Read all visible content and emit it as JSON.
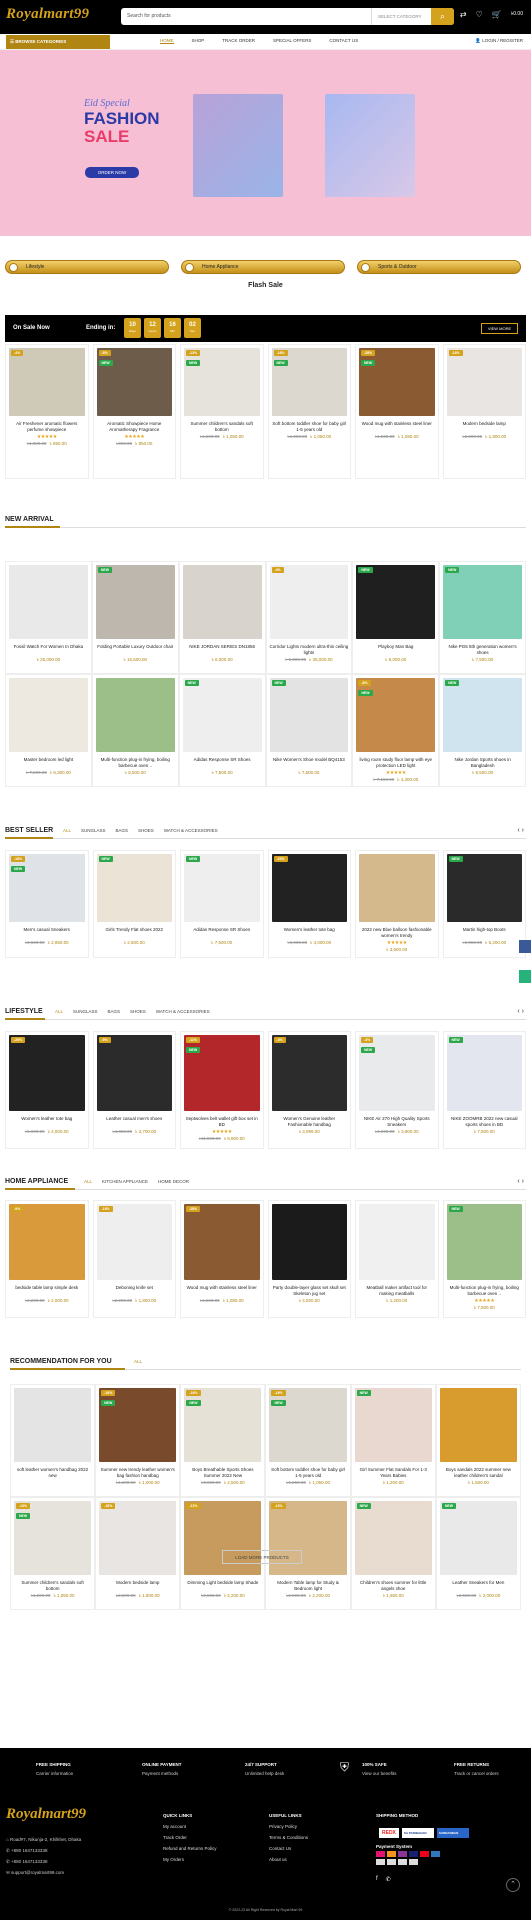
{
  "header": {
    "logo": "Royalmart99",
    "search_placeholder": "Search for products",
    "category_select": "SELECT CATEGORY",
    "search_icon": "search-icon",
    "cart_total": "৳0.00"
  },
  "nav": {
    "browse": "BROWSE CATEGORIES",
    "links": [
      "HOME",
      "SHOP",
      "TRACK ORDER",
      "SPECIAL OFFERS",
      "CONTACT US"
    ],
    "active": "HOME",
    "login": "LOGIN / REGISTER"
  },
  "banner": {
    "line1": "Eid Special",
    "line2": "FASHION",
    "line3": "SALE",
    "button": "ORDER NOW"
  },
  "categories": [
    "Lifestyle",
    "Home Appliance",
    "Sports & Outdoor"
  ],
  "flash": {
    "title": "Flash Sale",
    "on_sale": "On Sale Now",
    "ending": "Ending in:",
    "countdown": [
      {
        "v": "10",
        "u": "Days"
      },
      {
        "v": "12",
        "u": "Hours"
      },
      {
        "v": "16",
        "u": "Min"
      },
      {
        "v": "02",
        "u": "Sec"
      }
    ],
    "view_more": "VIEW MORE",
    "products": [
      {
        "name": "Air Freshener aromatic flowers perfume showpiece",
        "stars": "★★★★★",
        "old": "৳1,020.00",
        "price": "৳ 850.00",
        "badge": "-4%",
        "new": false,
        "color": "#cfc9b8"
      },
      {
        "name": "Aromatic Showpiece Home Aromatherapy Fragrance",
        "stars": "★★★★★",
        "old": "৳900.00",
        "price": "৳ 850.00",
        "badge": "-8%",
        "new": true,
        "color": "#6d5c4a"
      },
      {
        "name": "Summer children's sandals soft bottom",
        "stars": "",
        "old": "৳1,200.00",
        "price": "৳ 1,050.00",
        "badge": "-13%",
        "new": true,
        "color": "#e6e2dc"
      },
      {
        "name": "Soft bottom toddler shoe for baby girl 1-5 years old",
        "stars": "",
        "old": "৳1,250.00",
        "price": "৳ 1,050.00",
        "badge": "-16%",
        "new": true,
        "color": "#dcd7cf"
      },
      {
        "name": "Wood mug with stainless steel liner",
        "stars": "",
        "old": "৳1,500.00",
        "price": "৳ 1,080.00",
        "badge": "-28%",
        "new": true,
        "color": "#8a5a33"
      },
      {
        "name": "Modern bedside lamp",
        "stars": "",
        "old": "৳2,200.00",
        "price": "৳ 1,800.00",
        "badge": "-18%",
        "new": false,
        "color": "#e9e5e2"
      }
    ]
  },
  "new_arrival": {
    "title": "NEW ARRIVAL",
    "products": [
      {
        "name": "Fossil Watch For Women In Dhaka",
        "stars": "",
        "old": "",
        "price": "৳ 25,000.00",
        "badge": "",
        "new": false,
        "color": "#e9e9e9"
      },
      {
        "name": "Folding Portable Luxury Outdoor chair",
        "stars": "",
        "old": "",
        "price": "৳ 15,500.00",
        "badge": "",
        "new": true,
        "color": "#bdb7ae"
      },
      {
        "name": "NIKE JORDAN SERIES DN1856",
        "stars": "",
        "old": "",
        "price": "৳ 6,000.00",
        "badge": "",
        "new": false,
        "color": "#d8d3cd"
      },
      {
        "name": "Corridor Lights modern ultra-thin ceiling lights",
        "stars": "",
        "old": "৳ 1,000.00",
        "price": "৳ 35,000.00",
        "badge": "-4%",
        "new": false,
        "color": "#eeeeee"
      },
      {
        "name": "Playboy Man Bag",
        "stars": "",
        "old": "",
        "price": "৳ 8,000.00",
        "badge": "",
        "new": true,
        "color": "#1f1f1f"
      },
      {
        "name": "Nike PG5 5th generation women's shoes",
        "stars": "",
        "old": "",
        "price": "৳ 7,500.00",
        "badge": "",
        "new": true,
        "color": "#7fd0b6"
      },
      {
        "name": "Master bedroom led light",
        "stars": "",
        "old": "৳ 7,200.00",
        "price": "৳ 6,300.00",
        "badge": "",
        "new": false,
        "color": "#ede8e0"
      },
      {
        "name": "Multi-function plug-in frying, boiling barbecue oven ..",
        "stars": "",
        "old": "",
        "price": "৳ 8,500.00",
        "badge": "",
        "new": false,
        "color": "#9cbf8a"
      },
      {
        "name": "Adidas Response SR Shoes",
        "stars": "",
        "old": "",
        "price": "৳ 7,500.00",
        "badge": "",
        "new": true,
        "color": "#eeeeee"
      },
      {
        "name": "Nike Women's Shoe model BQ4153",
        "stars": "",
        "old": "",
        "price": "৳ 7,500.00",
        "badge": "",
        "new": true,
        "color": "#e3e3e3"
      },
      {
        "name": "living room study floor lamp with eye protection LED light",
        "stars": "★★★★★",
        "old": "৳ 7,150.00",
        "price": "৳ 4,300.00",
        "badge": "-8%",
        "new": true,
        "color": "#c58a4a"
      },
      {
        "name": "Nike Jordan Sports shoes in Bangladesh",
        "stars": "",
        "old": "",
        "price": "৳ 9,500.00",
        "badge": "",
        "new": true,
        "color": "#cfe4ef"
      }
    ]
  },
  "best_seller": {
    "title": "BEST SELLER",
    "tabs": [
      "ALL",
      "SUNGLASS",
      "BAGS",
      "SHOES",
      "WATCH & ACCESSORIES"
    ],
    "products": [
      {
        "name": "Men's casual Sneakers",
        "stars": "",
        "old": "৳3,500.00",
        "price": "৳ 2,950.00",
        "badge": "-16%",
        "new": true,
        "color": "#dfe2e6"
      },
      {
        "name": "Girls Trendy Flat shoes 2022",
        "stars": "",
        "old": "",
        "price": "৳ 2,500.00",
        "badge": "",
        "new": true,
        "color": "#eae3d6"
      },
      {
        "name": "Adidas Response SR Shoes",
        "stars": "",
        "old": "",
        "price": "৳ 7,500.00",
        "badge": "",
        "new": true,
        "color": "#eeeeee"
      },
      {
        "name": "Women's leather tote bag",
        "stars": "",
        "old": "৳5,000.00",
        "price": "৳ 4,000.00",
        "badge": "-20%",
        "new": false,
        "color": "#222222"
      },
      {
        "name": "2022 new Blue balloon fashionable women's trendy",
        "stars": "★★★★★",
        "old": "",
        "price": "৳ 3,500.00",
        "badge": "",
        "new": false,
        "color": "#d4b98c"
      },
      {
        "name": "Martin high-top Boots",
        "stars": "",
        "old": "৳6,950.00",
        "price": "৳ 6,200.00",
        "badge": "",
        "new": true,
        "color": "#2a2a2a"
      }
    ]
  },
  "lifestyle": {
    "title": "LIFESTYLE",
    "tabs": [
      "ALL",
      "SUNGLASS",
      "BAGS",
      "SHOES",
      "WATCH & ACCESSORIES"
    ],
    "products": [
      {
        "name": "Women's leather tote bag",
        "stars": "",
        "old": "৳5,000.00",
        "price": "৳ 4,000.00",
        "badge": "-20%",
        "new": false,
        "color": "#222222"
      },
      {
        "name": "Leather casual men's shoes",
        "stars": "",
        "old": "৳4,050.00",
        "price": "৳ 3,700.00",
        "badge": "-9%",
        "new": false,
        "color": "#2b2b2b"
      },
      {
        "name": "Septwolves belt wallet gift box set in BD",
        "stars": "★★★★★",
        "old": "৳11,000.00",
        "price": "৳ 9,800.00",
        "badge": "-11%",
        "new": true,
        "color": "#b3262a"
      },
      {
        "name": "Women's Genuine leather Fashionable handbag",
        "stars": "",
        "old": "",
        "price": "৳ 3,999.00",
        "badge": "-4%",
        "new": false,
        "color": "#2c2c2c"
      },
      {
        "name": "NIKE Air 270 High Quality Sports Sneakers",
        "stars": "",
        "old": "৳4,000.00",
        "price": "৳ 3,900.00",
        "badge": "-3%",
        "new": true,
        "color": "#e8eaec"
      },
      {
        "name": "NIKE ZOOMRB 2022 new casual sports shoes in BD",
        "stars": "",
        "old": "",
        "price": "৳ 7,500.00",
        "badge": "",
        "new": true,
        "color": "#e3e6ef"
      }
    ]
  },
  "home_appliance": {
    "title": "HOME APPLIANCE",
    "tabs": [
      "ALL",
      "KITCHEN APPLIANCE",
      "HOME DECOR"
    ],
    "products": [
      {
        "name": "bedside table lamp simple desk",
        "stars": "",
        "old": "৳2,200.00",
        "price": "৳ 2,000.00",
        "badge": "-9%",
        "new": false,
        "color": "#d89a3a"
      },
      {
        "name": "Deboning knife set",
        "stars": "",
        "old": "৳2,200.00",
        "price": "৳ 1,800.00",
        "badge": "-18%",
        "new": false,
        "color": "#eeeeee"
      },
      {
        "name": "Wood mug with stainless steel liner",
        "stars": "",
        "old": "৳1,500.00",
        "price": "৳ 1,080.00",
        "badge": "-28%",
        "new": false,
        "color": "#8a5a33"
      },
      {
        "name": "Party double-layer glass set skull set Skeleton jug set",
        "stars": "",
        "old": "",
        "price": "৳ 4,500.00",
        "badge": "",
        "new": false,
        "color": "#1b1b1b"
      },
      {
        "name": "Meatball maker artifact tool for making meatballs",
        "stars": "",
        "old": "",
        "price": "৳ 1,200.00",
        "badge": "",
        "new": false,
        "color": "#f0f0f0"
      },
      {
        "name": "Multi-function plug-in frying, boiling barbecue oven ..",
        "stars": "★★★★★",
        "old": "",
        "price": "৳ 7,500.00",
        "badge": "",
        "new": true,
        "color": "#9cbf8a"
      }
    ]
  },
  "recommendation": {
    "title": "RECOMMENDATION FOR YOU",
    "tabs": [
      "ALL"
    ],
    "products": [
      {
        "name": "soft leather women's handbag 2022 new",
        "stars": "",
        "old": "",
        "price": "",
        "badge": "",
        "new": false,
        "color": "#e4e4e4"
      },
      {
        "name": "Summer new trendy leather women's bag fashion handbag",
        "stars": "",
        "old": "৳1,200.00",
        "price": "৳ 1,000.00",
        "badge": "-16%",
        "new": true,
        "color": "#7a4a2c"
      },
      {
        "name": "Boys Breathable Sports Shoes Summer 2022 New",
        "stars": "",
        "old": "৳3,000.00",
        "price": "৳ 2,500.00",
        "badge": "-16%",
        "new": true,
        "color": "#e6e1d7"
      },
      {
        "name": "Soft bottom toddler shoe for baby girl 1-5 years old",
        "stars": "",
        "old": "৳1,250.00",
        "price": "৳ 1,050.00",
        "badge": "-16%",
        "new": true,
        "color": "#dcd7cf"
      },
      {
        "name": "Girl Summer Flat Sandals For 1-3 Years Babies",
        "stars": "",
        "old": "",
        "price": "৳ 1,200.00",
        "badge": "",
        "new": true,
        "color": "#e8d8cf"
      },
      {
        "name": "Boys sandals 2022 summer new leather children's sandal",
        "stars": "",
        "old": "",
        "price": "৳ 1,500.00",
        "badge": "",
        "new": false,
        "color": "#d89b2e"
      },
      {
        "name": "Summer children's sandals soft bottom",
        "stars": "",
        "old": "৳1,200.00",
        "price": "৳ 1,050.00",
        "badge": "-13%",
        "new": true,
        "color": "#e6e2dc"
      },
      {
        "name": "Modern bedside lamp",
        "stars": "",
        "old": "৳2,200.00",
        "price": "৳ 1,800.00",
        "badge": "-18%",
        "new": false,
        "color": "#e9e5e2"
      },
      {
        "name": "Dimming Light bedside lamp Shade",
        "stars": "",
        "old": "৳2,500.00",
        "price": "৳ 2,200.00",
        "badge": "-12%",
        "new": false,
        "color": "#c79a5e"
      },
      {
        "name": "Modern Table lamp for Study & Bedroom light",
        "stars": "",
        "old": "৳2,500.00",
        "price": "৳ 2,200.00",
        "badge": "-12%",
        "new": false,
        "color": "#d5b78a"
      },
      {
        "name": "Children's shoes summer for little angels shoe",
        "stars": "",
        "old": "",
        "price": "৳ 1,650.00",
        "badge": "",
        "new": true,
        "color": "#e8dcd0"
      },
      {
        "name": "Leather Sneakers for Men",
        "stars": "",
        "old": "৳2,500.00",
        "price": "৳ 2,000.00",
        "badge": "",
        "new": true,
        "color": "#e9e9e9"
      }
    ],
    "load_more": "LOAD MORE PRODUCTS"
  },
  "footer": {
    "features": [
      {
        "t": "FREE SHIPPING",
        "s": "Carrier information"
      },
      {
        "t": "ONLINE PAYMENT",
        "s": "Payment methods"
      },
      {
        "t": "24/7 SUPPORT",
        "s": "Unlimited help desk"
      },
      {
        "t": "100% SAFE",
        "s": "View our benefits"
      },
      {
        "t": "FREE RETURNS",
        "s": "Track or cancel orders"
      }
    ],
    "address": "Road#7, Nikunja-2, Khilkhet, Dhaka",
    "phone1": "+880 1647133338",
    "phone2": "+880 1647133338",
    "email": "support@royalmart99.com",
    "quick_title": "QUICK LINKS",
    "quick": [
      "My account",
      "Track Order",
      "Refund and Returns Policy",
      "My Orders"
    ],
    "useful_title": "USEFUL LINKS",
    "useful": [
      "Privacy Policy",
      "Terms & Conditions",
      "Contact Us",
      "About us"
    ],
    "ship_title": "SHIPPING METHOD",
    "ship": [
      "REDX",
      "SA PARIBAHAN",
      "SUNDARBAN"
    ],
    "pay_title": "Payment System",
    "copyright": "© 2022-23 All Right Reserved by Royal Mart 99"
  }
}
